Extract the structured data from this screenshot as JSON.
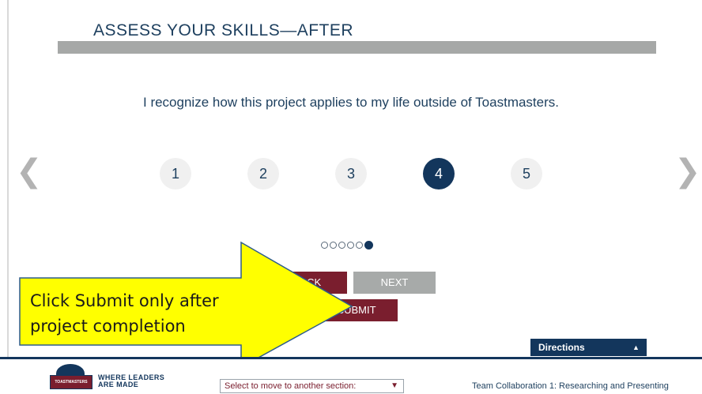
{
  "heading": "ASSESS YOUR SKILLS—AFTER",
  "question": "I recognize how this project applies to my life outside of Toastmasters.",
  "rating": {
    "options": [
      "1",
      "2",
      "3",
      "4",
      "5"
    ],
    "selected": 4
  },
  "nav_arrows": {
    "prev": "❮",
    "next": "❯"
  },
  "pagination": {
    "total": 6,
    "current": 6
  },
  "buttons": {
    "back": "BACK",
    "next": "NEXT",
    "submit": "SUBMIT"
  },
  "callout": {
    "line1": "Click Submit only after",
    "line2": "project completion"
  },
  "directions": {
    "label": "Directions",
    "caret": "▲"
  },
  "footer": {
    "logo_text": "TOASTMASTERS",
    "tagline_line1": "WHERE LEADERS",
    "tagline_line2": "ARE MADE",
    "section_select": "Select to move to another section:",
    "section_chevron": "▼",
    "course_title": "Team Collaboration 1: Researching and Presenting"
  },
  "colors": {
    "navy": "#13365c",
    "maroon": "#7a1e2e",
    "gray_button": "#a7aaa9",
    "callout_yellow": "#ffff00"
  }
}
